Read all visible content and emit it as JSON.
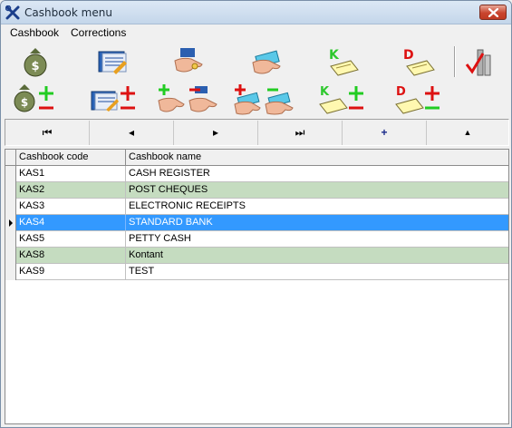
{
  "window": {
    "title": "Cashbook menu"
  },
  "menu": [
    {
      "label": "Cashbook"
    },
    {
      "label": "Corrections"
    }
  ],
  "toolbar1": [
    {
      "icon": "money-bag-icon"
    },
    {
      "icon": "cashbook-ledger-icon"
    },
    {
      "icon": "hand-coins-icon"
    },
    {
      "icon": "hand-cheque-icon"
    },
    {
      "icon": "kredit-document-icon"
    },
    {
      "icon": "debit-document-icon"
    },
    {
      "icon": "report-chart-icon"
    }
  ],
  "toolbar2": [
    {
      "icon": "money-bag-add-remove-icon"
    },
    {
      "icon": "ledger-add-remove-icon"
    },
    {
      "icon": "hand-coins-add-remove-icon"
    },
    {
      "icon": "hand-cheque-add-remove-icon"
    },
    {
      "icon": "kredit-add-remove-icon"
    },
    {
      "icon": "debit-add-remove-icon"
    }
  ],
  "navigator": {
    "first": "⏮",
    "prior": "◂",
    "next": "▸",
    "last": "⏭",
    "insert": "+",
    "delete": "▲"
  },
  "grid": {
    "columns": [
      "Cashbook code",
      "Cashbook name"
    ],
    "rows": [
      {
        "code": "KAS1",
        "name": "CASH REGISTER"
      },
      {
        "code": "KAS2",
        "name": "POST CHEQUES"
      },
      {
        "code": "KAS3",
        "name": "ELECTRONIC RECEIPTS"
      },
      {
        "code": "KAS4",
        "name": "STANDARD BANK",
        "selected": true
      },
      {
        "code": "KAS5",
        "name": "PETTY CASH"
      },
      {
        "code": "KAS8",
        "name": "Kontant"
      },
      {
        "code": "KAS9",
        "name": "TEST"
      }
    ]
  },
  "colors": {
    "selection": "#3399ff",
    "alt_row": "#c5dcc0",
    "close_button": "#c9452e",
    "plus": "#22cc22",
    "minus": "#dd1111"
  }
}
